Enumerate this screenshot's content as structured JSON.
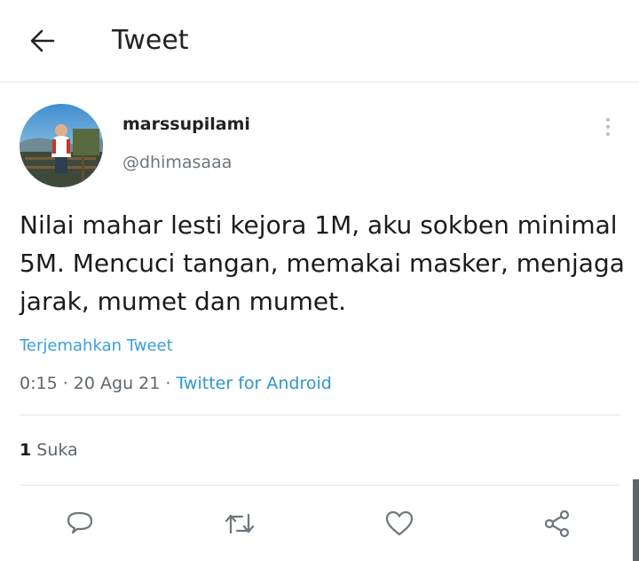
{
  "header": {
    "title": "Tweet",
    "back_icon": "arrow-left-icon"
  },
  "tweet": {
    "display_name": "marssupilami",
    "handle": "@dhimasaaa",
    "text": "Nilai mahar lesti kejora 1M, aku sokben minimal 5M. Mencuci tangan, memakai masker, menjaga jarak, mumet dan mumet.",
    "translate_label": "Terjemahkan Tweet",
    "time": "0:15",
    "date": "20 Agu 21",
    "separator": " · ",
    "source": "Twitter for Android",
    "likes_count": "1",
    "likes_label": "Suka"
  },
  "actions": [
    {
      "name": "reply",
      "icon": "reply-icon"
    },
    {
      "name": "retweet",
      "icon": "retweet-icon"
    },
    {
      "name": "like",
      "icon": "heart-icon"
    },
    {
      "name": "share",
      "icon": "share-icon"
    }
  ],
  "colors": {
    "link": "#2f95d0",
    "muted": "#5d666d",
    "icon": "#6d767d",
    "divider": "#e1e4e6"
  }
}
